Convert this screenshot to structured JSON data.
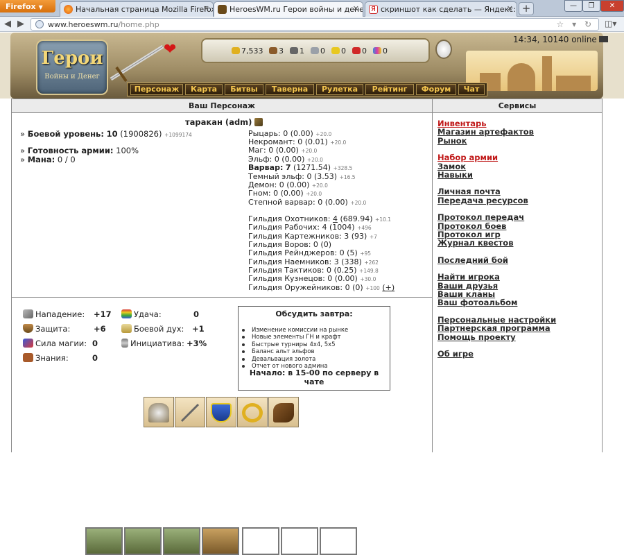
{
  "browser": {
    "app_button": "Firefox",
    "tabs": [
      {
        "title": "Начальная страница Mozilla Firefox",
        "active": false
      },
      {
        "title": "HeroesWM.ru Герои войны и денег. ...",
        "active": true
      },
      {
        "title": "скриншот как сделать — Яндекс: на...",
        "active": false
      }
    ],
    "new_tab": "+",
    "url_host": "www.heroeswm.ru",
    "url_path": "/home.php"
  },
  "header": {
    "logo_title": "Герои",
    "logo_subtitle": "Войны и Денег",
    "resources": [
      {
        "icon": "gold-icon",
        "value": "7,533"
      },
      {
        "icon": "wood-icon",
        "value": "3"
      },
      {
        "icon": "ore-icon",
        "value": "1"
      },
      {
        "icon": "mercury-icon",
        "value": "0"
      },
      {
        "icon": "sulfur-icon",
        "value": "0"
      },
      {
        "icon": "crystals-icon",
        "value": "0"
      },
      {
        "icon": "gems-icon",
        "value": "0"
      }
    ],
    "time_online": "14:34, 10140 online",
    "menu": [
      "Персонаж",
      "Карта",
      "Битвы",
      "Таверна",
      "Рулетка",
      "Рейтинг",
      "Форум",
      "Чат"
    ]
  },
  "main": {
    "title": "Ваш Персонаж",
    "char_name": "таракан (adm)",
    "combat_level_label": "Боевой уровень:",
    "combat_level": "10",
    "combat_exp": "(1900826)",
    "combat_exp_delta": "+1099174",
    "army_ready_label": "Готовность армии:",
    "army_ready": "100%",
    "mana_label": "Мана:",
    "mana": "0 / 0",
    "factions": [
      {
        "name": "Рыцарь:",
        "value": "0 (0.00)",
        "delta": "+20.0",
        "bold": false
      },
      {
        "name": "Некромант:",
        "value": "0 (0.01)",
        "delta": "+20.0",
        "bold": false
      },
      {
        "name": "Маг:",
        "value": "0 (0.00)",
        "delta": "+20.0",
        "bold": false
      },
      {
        "name": "Эльф:",
        "value": "0 (0.00)",
        "delta": "+20.0",
        "bold": false
      },
      {
        "name": "Варвар:",
        "value": "7",
        "extra": "(1271.54)",
        "delta": "+328.5",
        "bold": true
      },
      {
        "name": "Темный эльф:",
        "value": "0 (3.53)",
        "delta": "+16.5",
        "bold": false
      },
      {
        "name": "Демон:",
        "value": "0 (0.00)",
        "delta": "+20.0",
        "bold": false
      },
      {
        "name": "Гном:",
        "value": "0 (0.00)",
        "delta": "+20.0",
        "bold": false
      },
      {
        "name": "Степной варвар:",
        "value": "0 (0.00)",
        "delta": "+20.0",
        "bold": false
      }
    ],
    "guilds": [
      {
        "name": "Гильдия Охотников:",
        "value": "4",
        "extra": "(689.94)",
        "delta": "+10.1",
        "link": true
      },
      {
        "name": "Гильдия Рабочих:",
        "value": "4 (1004)",
        "delta": "+496"
      },
      {
        "name": "Гильдия Картежников:",
        "value": "3 (93)",
        "delta": "+7"
      },
      {
        "name": "Гильдия Воров:",
        "value": "0 (0)",
        "delta": ""
      },
      {
        "name": "Гильдия Рейнджеров:",
        "value": "0 (5)",
        "delta": "+95"
      },
      {
        "name": "Гильдия Наемников:",
        "value": "3 (338)",
        "delta": "+262"
      },
      {
        "name": "Гильдия Тактиков:",
        "value": "0 (0.25)",
        "delta": "+149.8"
      },
      {
        "name": "Гильдия Кузнецов:",
        "value": "0 (0.00)",
        "delta": "+30.0"
      },
      {
        "name": "Гильдия Оружейников:",
        "value": "0 (0)",
        "delta": "+100",
        "plus": "(+)"
      }
    ],
    "stats_left": [
      {
        "icon": "swords-icon",
        "label": "Нападение:",
        "value": "+17"
      },
      {
        "icon": "shield-icon",
        "label": "Защита:",
        "value": "+6"
      },
      {
        "icon": "magic-wand-icon",
        "label": "Сила магии:",
        "value": "0"
      },
      {
        "icon": "book-icon",
        "label": "Знания:",
        "value": "0"
      }
    ],
    "stats_right": [
      {
        "icon": "rainbow-icon",
        "label": "Удача:",
        "value": "0"
      },
      {
        "icon": "wings-icon",
        "label": "Боевой дух:",
        "value": "+1"
      },
      {
        "icon": "hourglass-icon",
        "label": "Инициатива:",
        "value": "+3%"
      }
    ],
    "discuss": {
      "title": "Обсудить завтра:",
      "items": [
        "Изменение комиссии на рынке",
        "Новые элементы ГН и крафт",
        "Быстрые турниры 4х4, 5х5",
        "Баланс альт эльфов",
        "Девальвация золота",
        "Отчет от нового админа"
      ],
      "footer": "Начало: в 15-00 по серверу в чате"
    },
    "equipment": [
      "helmet-icon",
      "sword-icon",
      "shield-icon",
      "ring-icon",
      "horse-icon"
    ]
  },
  "services": {
    "title": "Сервисы",
    "links": [
      {
        "label": "Инвентарь",
        "red": true
      },
      {
        "label": "Магазин артефактов"
      },
      {
        "label": "Рынок"
      },
      {
        "label": "Набор армии",
        "red": true
      },
      {
        "label": "Замок"
      },
      {
        "label": "Навыки"
      },
      {
        "label": "Личная почта"
      },
      {
        "label": "Передача ресурсов"
      },
      {
        "label": "Протокол передач"
      },
      {
        "label": "Протокол боев"
      },
      {
        "label": "Протокол игр"
      },
      {
        "label": "Журнал квестов"
      },
      {
        "label": "Последний бой"
      },
      {
        "label": "Найти игрока"
      },
      {
        "label": "Ваши друзья"
      },
      {
        "label": "Ваши кланы"
      },
      {
        "label": "Ваш фотоальбом"
      },
      {
        "label": "Персональные настройки"
      },
      {
        "label": "Партнерская программа"
      },
      {
        "label": "Помощь проекту"
      },
      {
        "label": "Об игре"
      }
    ]
  }
}
